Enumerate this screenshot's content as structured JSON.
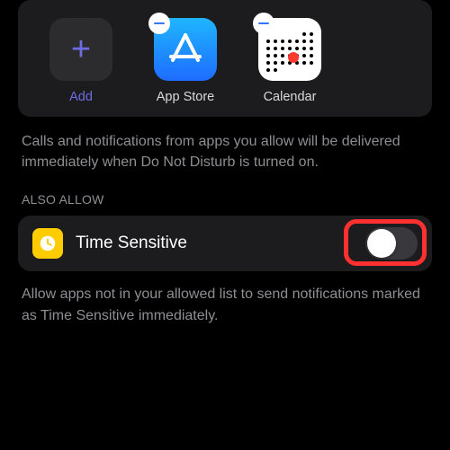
{
  "apps_card": {
    "add_label": "Add",
    "items": [
      {
        "label": "App Store",
        "icon": "appstore-icon"
      },
      {
        "label": "Calendar",
        "icon": "calendar-icon"
      }
    ]
  },
  "description1": "Calls and notifications from apps you allow will be delivered immediately when Do Not Disturb is turned on.",
  "section_header": "ALSO ALLOW",
  "time_sensitive": {
    "label": "Time Sensitive",
    "enabled": false
  },
  "description2": "Allow apps not in your allowed list to send notifications marked as Time Sensitive immediately."
}
